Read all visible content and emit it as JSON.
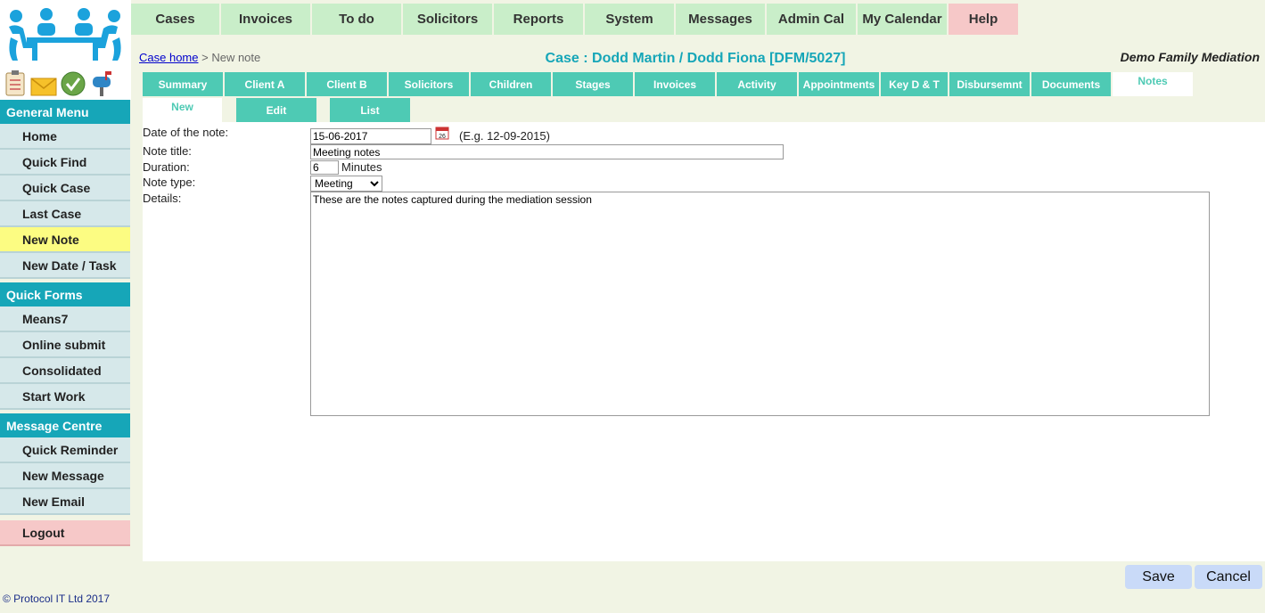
{
  "top_nav": [
    {
      "label": "Cases"
    },
    {
      "label": "Invoices"
    },
    {
      "label": "To do"
    },
    {
      "label": "Solicitors"
    },
    {
      "label": "Reports"
    },
    {
      "label": "System"
    },
    {
      "label": "Messages"
    },
    {
      "label": "Admin Cal"
    },
    {
      "label": "My Calendar"
    },
    {
      "label": "Help"
    }
  ],
  "sidebar": {
    "general_header": "General Menu",
    "general_items": [
      "Home",
      "Quick Find",
      "Quick Case",
      "Last Case",
      "New Note",
      "New Date / Task"
    ],
    "quickforms_header": "Quick Forms",
    "quickforms_items": [
      "Means7",
      "Online submit",
      "Consolidated",
      "Start Work"
    ],
    "message_header": "Message Centre",
    "message_items": [
      "Quick Reminder",
      "New Message",
      "New Email"
    ],
    "logout": "Logout",
    "active": "New Note"
  },
  "copyright": "© Protocol IT Ltd 2017",
  "breadcrumb": {
    "home": "Case home",
    "separator": ">",
    "current": "New note"
  },
  "case_title": "Case : Dodd Martin / Dodd Fiona [DFM/5027]",
  "org_name": "Demo Family Mediation",
  "section_tabs": [
    "Summary",
    "Client A",
    "Client B",
    "Solicitors",
    "Children",
    "Stages",
    "Invoices",
    "Activity",
    "Appointments",
    "Key D & T",
    "Disbursemnt",
    "Documents",
    "Notes"
  ],
  "active_tab": "Notes",
  "sub_tabs": [
    "New",
    "Edit",
    "List"
  ],
  "form": {
    "date_label": "Date of the note:",
    "date_value": "15-06-2017",
    "date_hint": "(E.g. 12-09-2015)",
    "calendar_day": "26",
    "title_label": "Note title:",
    "title_value": "Meeting notes",
    "duration_label": "Duration:",
    "duration_value": "6",
    "duration_unit": "Minutes",
    "type_label": "Note type:",
    "type_value": "Meeting",
    "details_label": "Details:",
    "details_value": "These are the notes captured during the mediation session"
  },
  "buttons": {
    "save": "Save",
    "cancel": "Cancel"
  },
  "colors": {
    "accent": "#16a6b8",
    "tab": "#4ecab4",
    "nav": "#c9eec9",
    "help": "#f6c8c8",
    "active_item": "#fcfc82"
  }
}
